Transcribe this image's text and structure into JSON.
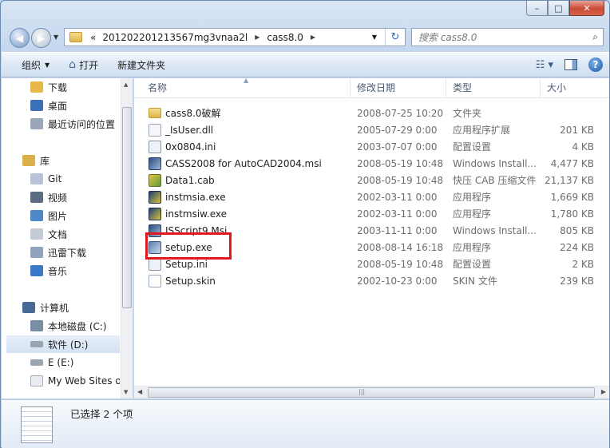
{
  "window": {
    "caption": {
      "minimize": "–",
      "maximize": "□",
      "close": "✕"
    }
  },
  "address_bar": {
    "overflow_chevron": "«",
    "crumbs": [
      "201202201213567mg3vnaa2l",
      "cass8.0"
    ],
    "separator": "▶",
    "dropdown": "▼",
    "refresh_icon": "↻"
  },
  "search": {
    "placeholder": "搜索 cass8.0",
    "icon": "⌕"
  },
  "toolbar": {
    "organize": "组织",
    "open": "打开",
    "new_folder": "新建文件夹"
  },
  "navpane": {
    "items": [
      {
        "label": "下载",
        "icon": "downloads-icon",
        "color": "#e7b94a"
      },
      {
        "label": "桌面",
        "icon": "desktop-icon",
        "color": "#3b6fb6"
      },
      {
        "label": "最近访问的位置",
        "icon": "recent-places-icon",
        "color": "#9aa7b8"
      },
      {
        "label": "库",
        "icon": "libraries-icon",
        "color": "#d9b04a"
      },
      {
        "label": "Git",
        "icon": "git-library-icon",
        "color": "#b6c4d6"
      },
      {
        "label": "视频",
        "icon": "videos-icon",
        "color": "#5a6b82"
      },
      {
        "label": "图片",
        "icon": "pictures-icon",
        "color": "#4f86c6"
      },
      {
        "label": "文档",
        "icon": "documents-icon",
        "color": "#c3cbd6"
      },
      {
        "label": "迅雷下载",
        "icon": "thunder-download-icon",
        "color": "#8fa3bd"
      },
      {
        "label": "音乐",
        "icon": "music-icon",
        "color": "#3c78c8"
      },
      {
        "label": "计算机",
        "icon": "computer-icon",
        "color": "#4a6a96"
      },
      {
        "label": "本地磁盘 (C:)",
        "icon": "local-disk-icon",
        "color": "#7b8ca5"
      },
      {
        "label": "软件 (D:)",
        "icon": "drive-icon",
        "color": "#9aa5b3"
      },
      {
        "label": "E (E:)",
        "icon": "drive-icon",
        "color": "#9aa5b3"
      },
      {
        "label": "My Web Sites o",
        "icon": "file-icon",
        "color": "#e9edf2"
      }
    ]
  },
  "columns": {
    "name": "名称",
    "date": "修改日期",
    "type": "类型",
    "size": "大小"
  },
  "files": [
    {
      "name": "cass8.0破解",
      "date": "2008-07-25 10:20",
      "type": "文件夹",
      "size": "",
      "icon": "folder"
    },
    {
      "name": "_IsUser.dll",
      "date": "2005-07-29 0:00",
      "type": "应用程序扩展",
      "size": "201 KB",
      "icon": "dll"
    },
    {
      "name": "0x0804.ini",
      "date": "2003-07-07 0:00",
      "type": "配置设置",
      "size": "4 KB",
      "icon": "ini"
    },
    {
      "name": "CASS2008 for AutoCAD2004.msi",
      "date": "2008-05-19 10:48",
      "type": "Windows Install...",
      "size": "4,477 KB",
      "icon": "msi"
    },
    {
      "name": "Data1.cab",
      "date": "2008-05-19 10:48",
      "type": "快压 CAB 压缩文件",
      "size": "21,137 KB",
      "icon": "cab"
    },
    {
      "name": "instmsia.exe",
      "date": "2002-03-11 0:00",
      "type": "应用程序",
      "size": "1,669 KB",
      "icon": "exe"
    },
    {
      "name": "instmsiw.exe",
      "date": "2002-03-11 0:00",
      "type": "应用程序",
      "size": "1,780 KB",
      "icon": "exe"
    },
    {
      "name": "ISScript9.Msi",
      "date": "2003-11-11 0:00",
      "type": "Windows Install...",
      "size": "805 KB",
      "icon": "msi"
    },
    {
      "name": "setup.exe",
      "date": "2008-08-14 16:18",
      "type": "应用程序",
      "size": "224 KB",
      "icon": "setup"
    },
    {
      "name": "Setup.ini",
      "date": "2008-05-19 10:48",
      "type": "配置设置",
      "size": "2 KB",
      "icon": "ini"
    },
    {
      "name": "Setup.skin",
      "date": "2002-10-23 0:00",
      "type": "SKIN 文件",
      "size": "239 KB",
      "icon": "skin"
    }
  ],
  "details_pane": {
    "status": "已选择 2 个项"
  },
  "colors": {
    "highlight_box": "#e0191f",
    "accent": "#2a6cc0"
  }
}
